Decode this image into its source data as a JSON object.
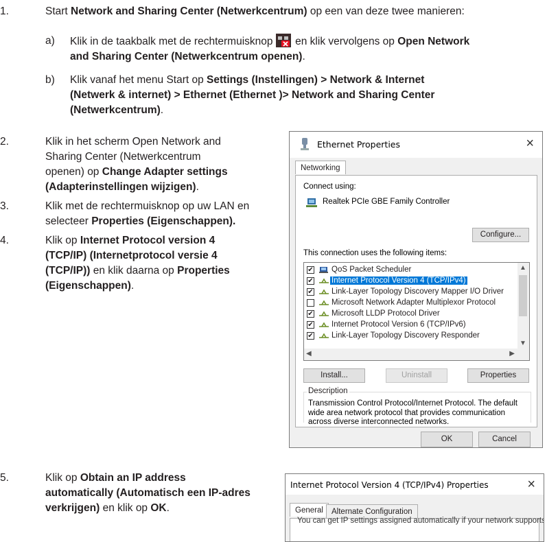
{
  "steps": {
    "s1": {
      "num": "1.",
      "pre": "Start ",
      "bold": "Network and Sharing Center (Netwerkcentrum)",
      "post": " op een van deze twee manieren:"
    },
    "s1a": {
      "num": "a)",
      "pre": "Klik in de taakbalk met de rechtermuisknop ",
      "mid": " en klik vervolgens op ",
      "bold1": "Open Network",
      "bold2": "and Sharing Center (Netwerkcentrum openen)",
      "post": "."
    },
    "s1b": {
      "num": "b)",
      "pre": "Klik vanaf het menu Start op ",
      "bold1": "Settings (Instellingen) > Network & Internet",
      "bold2": "(Netwerk & internet) > Ethernet (Ethernet )> Network and Sharing Center",
      "bold3": "(Netwerkcentrum)",
      "post": "."
    },
    "s2": {
      "num": "2.",
      "line1": "Klik in het scherm Open Network and",
      "line2": "Sharing Center (Netwerkcentrum",
      "line3a": "openen) op ",
      "bold1": "Change Adapter settings",
      "bold2": "(Adapterinstellingen wijzigen)",
      "post": "."
    },
    "s3": {
      "num": "3.",
      "line1": "Klik met de rechtermuisknop op uw LAN en",
      "line2a": "selecteer  ",
      "bold": "Properties (Eigenschappen)."
    },
    "s4": {
      "num": "4.",
      "pre": "Klik op ",
      "bold1": "Internet Protocol version 4",
      "bold2": "(TCP/IP) (Internetprotocol versie 4",
      "bold3": "(TCP/IP))",
      "mid": " en klik daarna op ",
      "bold4": "Properties",
      "bold5": "(Eigenschappen)",
      "post": "."
    },
    "s5": {
      "num": "5.",
      "pre": "Klik op ",
      "bold1": "Obtain an IP address",
      "bold2": "automatically (Automatisch een IP-adres",
      "bold3": "verkrijgen)",
      "mid": " en klik op ",
      "bold4": "OK",
      "post": "."
    }
  },
  "dialog1": {
    "title": "Ethernet Properties",
    "close": "×",
    "tab": "Networking",
    "connect_using": "Connect using:",
    "adapter": "Realtek PCIe GBE Family Controller",
    "configure": "Configure...",
    "items_label": "This connection uses the following items:",
    "items": [
      {
        "label": "QoS Packet Scheduler",
        "checked": true
      },
      {
        "label": "Internet Protocol Version 4 (TCP/IPv4)",
        "checked": true
      },
      {
        "label": "Link-Layer Topology Discovery Mapper I/O Driver",
        "checked": true
      },
      {
        "label": "Microsoft Network Adapter Multiplexor Protocol",
        "checked": false
      },
      {
        "label": "Microsoft LLDP Protocol Driver",
        "checked": true
      },
      {
        "label": "Internet Protocol Version 6 (TCP/IPv6)",
        "checked": true
      },
      {
        "label": "Link-Layer Topology Discovery Responder",
        "checked": true
      }
    ],
    "install": "Install...",
    "uninstall": "Uninstall",
    "properties": "Properties",
    "description_label": "Description",
    "description_l1": "Transmission Control Protocol/Internet Protocol. The default",
    "description_l2": "wide area network protocol that provides communication",
    "description_l3": "across diverse interconnected networks.",
    "ok": "OK",
    "cancel": "Cancel"
  },
  "dialog2": {
    "title": "Internet Protocol Version 4 (TCP/IPv4) Properties",
    "close": "×",
    "tab_general": "General",
    "tab_alternate": "Alternate Configuration",
    "partial_text": "You can get IP settings assigned automatically if your network supports"
  }
}
